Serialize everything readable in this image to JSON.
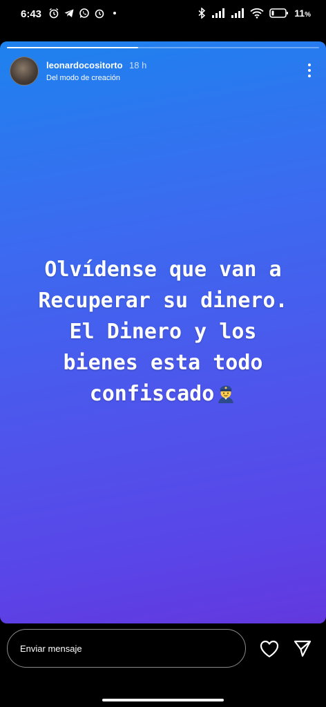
{
  "status_bar": {
    "time": "6:43",
    "battery_text": "11",
    "battery_unit": "%",
    "left_icons": [
      "alarm-icon",
      "telegram-icon",
      "whatsapp-icon",
      "alarm-icon"
    ],
    "right_icons": [
      "bluetooth-icon",
      "signal-icon",
      "signal-icon",
      "wifi-icon",
      "battery-icon"
    ]
  },
  "story": {
    "progress": 0.42,
    "username": "leonardocositorto",
    "time_ago": "18 h",
    "subtitle": "Del modo de creación",
    "text_lines": [
      "Olvídense que van a",
      "Recuperar su dinero.",
      "El Dinero y los",
      "bienes esta todo",
      "confiscado"
    ],
    "emoji": "police-officer-emoji"
  },
  "bottom_bar": {
    "message_placeholder": "Enviar mensaje",
    "icons": [
      "heart-icon",
      "send-icon"
    ]
  }
}
